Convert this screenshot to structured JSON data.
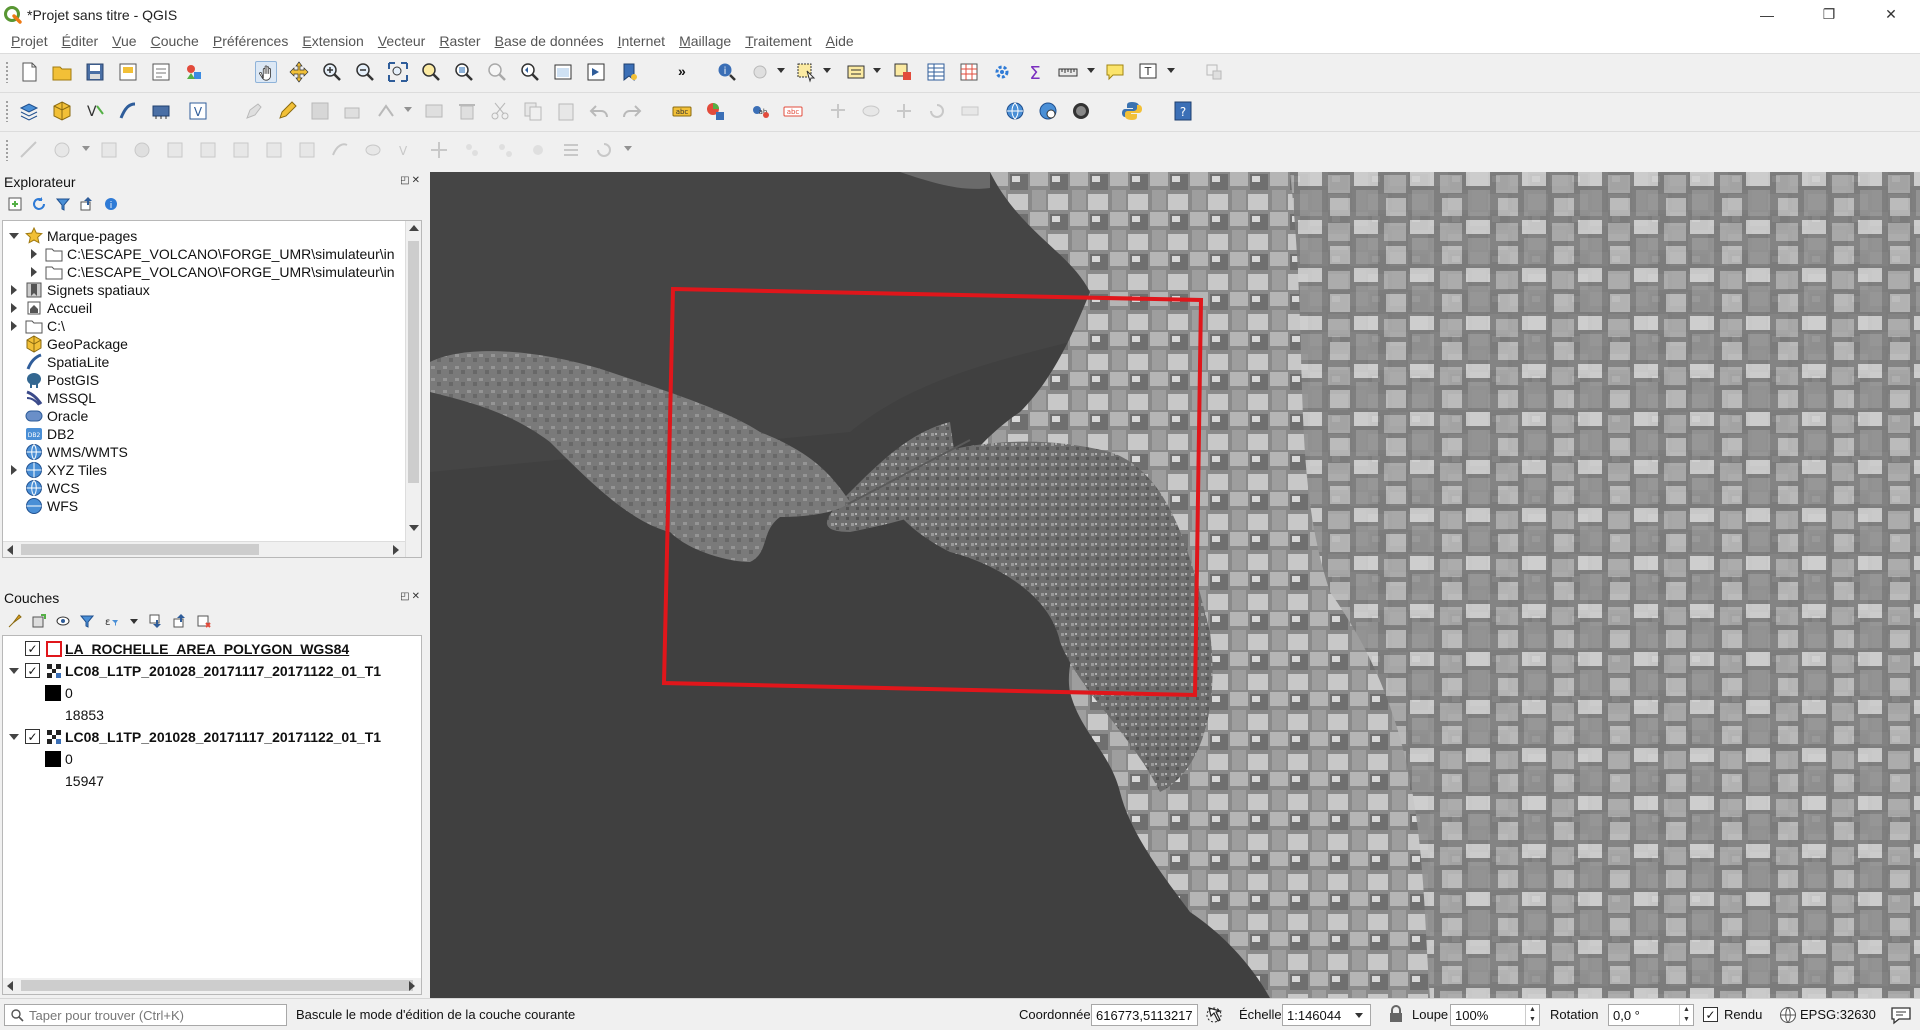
{
  "window": {
    "title": "*Projet sans titre - QGIS",
    "controls": {
      "minimize": "—",
      "restore": "❐",
      "close": "✕"
    }
  },
  "menubar": {
    "items": [
      {
        "mnemonic": "P",
        "rest": "rojet"
      },
      {
        "mnemonic": "É",
        "rest": "diter"
      },
      {
        "mnemonic": "V",
        "rest": "ue"
      },
      {
        "mnemonic": "C",
        "rest": "ouche"
      },
      {
        "mnemonic": "P",
        "rest": "références"
      },
      {
        "mnemonic": "E",
        "rest": "xtension"
      },
      {
        "mnemonic": "V",
        "rest": "ecteur"
      },
      {
        "mnemonic": "R",
        "rest": "aster"
      },
      {
        "mnemonic": "B",
        "rest": "ase de données"
      },
      {
        "mnemonic": "I",
        "rest": "nternet"
      },
      {
        "mnemonic": "M",
        "rest": "aillage"
      },
      {
        "mnemonic": "T",
        "rest": "raitement"
      },
      {
        "mnemonic": "A",
        "rest": "ide"
      }
    ],
    "more_chevron": "»"
  },
  "browser": {
    "title": "Explorateur",
    "panel_buttons": "◰✕",
    "items": [
      {
        "label": "Marque-pages",
        "icon": "star-icon",
        "expander": "down"
      },
      {
        "label": "C:\\ESCAPE_VOLCANO\\FORGE_UMR\\simulateur\\in",
        "icon": "folder-icon",
        "expander": "right",
        "indent": 1
      },
      {
        "label": "C:\\ESCAPE_VOLCANO\\FORGE_UMR\\simulateur\\in",
        "icon": "folder-icon",
        "expander": "right",
        "indent": 1
      },
      {
        "label": "Signets spatiaux",
        "icon": "spatial-bookmarks-icon",
        "expander": "right"
      },
      {
        "label": "Accueil",
        "icon": "home-icon",
        "expander": "right"
      },
      {
        "label": "C:\\",
        "icon": "folder-icon",
        "expander": "right"
      },
      {
        "label": "GeoPackage",
        "icon": "geopackage-icon",
        "expander": "none"
      },
      {
        "label": "SpatiaLite",
        "icon": "spatialite-icon",
        "expander": "none"
      },
      {
        "label": "PostGIS",
        "icon": "postgis-icon",
        "expander": "none"
      },
      {
        "label": "MSSQL",
        "icon": "mssql-icon",
        "expander": "none"
      },
      {
        "label": "Oracle",
        "icon": "oracle-icon",
        "expander": "none"
      },
      {
        "label": "DB2",
        "icon": "db2-icon",
        "expander": "none"
      },
      {
        "label": "WMS/WMTS",
        "icon": "wms-globe-icon",
        "expander": "none"
      },
      {
        "label": "XYZ Tiles",
        "icon": "xyz-tiles-icon",
        "expander": "right"
      },
      {
        "label": "WCS",
        "icon": "wcs-globe-icon",
        "expander": "none"
      },
      {
        "label": "WFS",
        "icon": "wfs-globe-icon",
        "expander": "none"
      }
    ]
  },
  "layers": {
    "title": "Couches",
    "panel_buttons": "◰✕",
    "items": [
      {
        "name": "LA_ROCHELLE_AREA_POLYGON_WGS84",
        "checked": true,
        "type": "polygon",
        "legend": []
      },
      {
        "name": "LC08_L1TP_201028_20171117_20171122_01_T1",
        "checked": true,
        "type": "raster",
        "legend": [
          "0",
          "18853"
        ]
      },
      {
        "name": "LC08_L1TP_201028_20171117_20171122_01_T1",
        "checked": true,
        "type": "raster",
        "legend": [
          "0",
          "15947"
        ]
      }
    ]
  },
  "statusbar": {
    "search_placeholder": "Taper pour trouver (Ctrl+K)",
    "message": "Bascule le mode d'édition de la couche courante",
    "coord_label": "Coordonnée",
    "coord_value": "616773,5113217",
    "scale_label": "Échelle",
    "scale_value": "1:146044",
    "magnifier_label": "Loupe",
    "magnifier_value": "100%",
    "rotation_label": "Rotation",
    "rotation_value": "0,0 °",
    "render_label": "Rendu",
    "render_checked": true,
    "crs": "EPSG:32630"
  },
  "map": {
    "polygon_outline_color": "#e0161b",
    "water_color": "#404040",
    "checkmark": "✓"
  }
}
